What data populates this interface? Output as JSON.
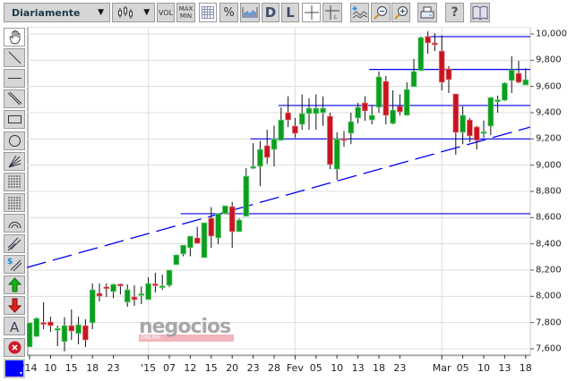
{
  "toolbar": {
    "period_select": "Diariamente",
    "chart_type_icon": "candlestick-icon",
    "vol_label": "VOL",
    "maxmin_label": "MAX MIN",
    "d_label": "D",
    "l_label": "L",
    "help_label": "?"
  },
  "left_tools": [
    "hand-icon",
    "line-icon",
    "horizontal-line-icon",
    "parallel-lines-icon",
    "rectangle-icon",
    "circle-icon",
    "fan-icon",
    "vertical-grid-icon",
    "horizontal-grid-icon",
    "arc-icon",
    "channel-icon",
    "dollar-channel-icon",
    "up-arrow-icon",
    "down-arrow-icon",
    "text-icon",
    "delete-icon",
    "color-picker-icon"
  ],
  "text_tool_label": "A",
  "colors": {
    "up": "#0b9e1f",
    "down": "#c8141f",
    "line": "#0000ee",
    "selected_color": "#0000ff"
  },
  "watermark": {
    "brand": "negocios",
    "sub": "ONLINE"
  },
  "chart_data": {
    "type": "candlestick",
    "ylim": [
      7550,
      10060
    ],
    "y_ticks": [
      {
        "v": 10000,
        "label": "10,000"
      },
      {
        "v": 9800,
        "label": "9,800"
      },
      {
        "v": 9600,
        "label": "9,600"
      },
      {
        "v": 9400,
        "label": "9,400"
      },
      {
        "v": 9200,
        "label": "9,200"
      },
      {
        "v": 9000,
        "label": "9,000"
      },
      {
        "v": 8800,
        "label": "8,800"
      },
      {
        "v": 8600,
        "label": "8,600"
      },
      {
        "v": 8400,
        "label": "8,400"
      },
      {
        "v": 8200,
        "label": "8,200"
      },
      {
        "v": 8000,
        "label": "8,000"
      },
      {
        "v": 7800,
        "label": "7,800"
      },
      {
        "v": 7600,
        "label": "7,600"
      }
    ],
    "x_ticks": [
      {
        "i": 0,
        "label": "'14"
      },
      {
        "i": 3,
        "label": "10"
      },
      {
        "i": 6,
        "label": "15"
      },
      {
        "i": 9,
        "label": "18"
      },
      {
        "i": 12,
        "label": "23"
      },
      {
        "i": 17,
        "label": "'15"
      },
      {
        "i": 20,
        "label": "07"
      },
      {
        "i": 23,
        "label": "12"
      },
      {
        "i": 26,
        "label": "15"
      },
      {
        "i": 29,
        "label": "20"
      },
      {
        "i": 32,
        "label": "23"
      },
      {
        "i": 35,
        "label": "28"
      },
      {
        "i": 38,
        "label": "Fev"
      },
      {
        "i": 41,
        "label": "05"
      },
      {
        "i": 44,
        "label": "10"
      },
      {
        "i": 47,
        "label": "13"
      },
      {
        "i": 50,
        "label": "18"
      },
      {
        "i": 53,
        "label": "23"
      },
      {
        "i": 59,
        "label": "Mar"
      },
      {
        "i": 62,
        "label": "05"
      },
      {
        "i": 65,
        "label": "10"
      },
      {
        "i": 68,
        "label": "13"
      },
      {
        "i": 71,
        "label": "18"
      }
    ],
    "v_grid_at": [
      17,
      38,
      59
    ],
    "ohlc": [
      [
        7614,
        7798,
        7614,
        7798
      ],
      [
        7695,
        7840,
        7690,
        7832
      ],
      [
        7800,
        7955,
        7750,
        7795
      ],
      [
        7805,
        7845,
        7730,
        7777
      ],
      [
        7750,
        7777,
        7620,
        7755
      ],
      [
        7655,
        7840,
        7580,
        7777
      ],
      [
        7777,
        7900,
        7668,
        7736
      ],
      [
        7716,
        7845,
        7634,
        7784
      ],
      [
        7777,
        7825,
        7614,
        7668
      ],
      [
        7798,
        8098,
        7750,
        8050
      ],
      [
        8023,
        8098,
        7961,
        8002
      ],
      [
        8072,
        8098,
        7995,
        8065
      ],
      [
        8036,
        8098,
        7985,
        8091
      ],
      [
        8093,
        8098,
        8015,
        8088
      ],
      [
        7955,
        8091,
        7920,
        8050
      ],
      [
        7995,
        8084,
        7927,
        7975
      ],
      [
        8015,
        8075,
        7940,
        8020
      ],
      [
        7975,
        8145,
        7975,
        8098
      ],
      [
        8095,
        8180,
        8030,
        8090
      ],
      [
        8075,
        8165,
        8050,
        8080
      ],
      [
        8084,
        8200,
        8070,
        8200
      ],
      [
        8241,
        8316,
        8241,
        8316
      ],
      [
        8323,
        8390,
        8305,
        8390
      ],
      [
        8370,
        8459,
        8305,
        8459
      ],
      [
        8445,
        8530,
        8404,
        8404
      ],
      [
        8295,
        8561,
        8295,
        8561
      ],
      [
        8595,
        8680,
        8370,
        8459
      ],
      [
        8445,
        8630,
        8398,
        8630
      ],
      [
        8630,
        8690,
        8630,
        8690
      ],
      [
        8684,
        8720,
        8370,
        8493
      ],
      [
        8493,
        8595,
        8500,
        8582
      ],
      [
        8610,
        8977,
        8610,
        8916
      ],
      [
        8985,
        9168,
        8970,
        8990
      ],
      [
        8991,
        9185,
        8841,
        9120
      ],
      [
        9148,
        9270,
        9010,
        9059
      ],
      [
        9120,
        9300,
        8990,
        9200
      ],
      [
        9189,
        9440,
        9189,
        9345
      ],
      [
        9400,
        9525,
        9290,
        9345
      ],
      [
        9298,
        9360,
        9209,
        9243
      ],
      [
        9311,
        9540,
        9270,
        9393
      ],
      [
        9393,
        9510,
        9270,
        9434
      ],
      [
        9393,
        9540,
        9270,
        9434
      ],
      [
        9400,
        9525,
        9300,
        9434
      ],
      [
        9373,
        9400,
        8970,
        9005
      ],
      [
        8970,
        9250,
        8889,
        9200
      ],
      [
        9202,
        9260,
        9140,
        9190
      ],
      [
        9243,
        9400,
        9160,
        9332
      ],
      [
        9359,
        9475,
        9318,
        9441
      ],
      [
        9475,
        9525,
        9338,
        9414
      ],
      [
        9345,
        9455,
        9311,
        9380
      ],
      [
        9441,
        9714,
        9400,
        9673
      ],
      [
        9639,
        9680,
        9311,
        9380
      ],
      [
        9318,
        9570,
        9311,
        9420
      ],
      [
        9448,
        9540,
        9380,
        9407
      ],
      [
        9380,
        9632,
        9380,
        9577
      ],
      [
        9598,
        9810,
        9598,
        9714
      ],
      [
        9720,
        9980,
        9720,
        9973
      ],
      [
        9980,
        10020,
        9850,
        9932
      ],
      [
        9932,
        10005,
        9870,
        9918
      ],
      [
        9870,
        9990,
        9570,
        9632
      ],
      [
        9734,
        9755,
        9550,
        9652
      ],
      [
        9543,
        9543,
        9080,
        9250
      ],
      [
        9250,
        9448,
        9160,
        9380
      ],
      [
        9345,
        9360,
        9175,
        9223
      ],
      [
        9291,
        9300,
        9120,
        9189
      ],
      [
        9250,
        9340,
        9210,
        9255
      ],
      [
        9298,
        9516,
        9230,
        9516
      ],
      [
        9493,
        9530,
        9400,
        9498
      ],
      [
        9495,
        9632,
        9489,
        9625
      ],
      [
        9645,
        9830,
        9550,
        9727
      ],
      [
        9700,
        9795,
        9625,
        9632
      ],
      [
        9611,
        9740,
        9618,
        9652
      ]
    ],
    "horizontal_lines": [
      {
        "v": 9980,
        "from": 57
      },
      {
        "v": 9730,
        "from": 49
      },
      {
        "v": 9455,
        "from": 36
      },
      {
        "v": 9200,
        "from": 32
      },
      {
        "v": 8630,
        "from": 22
      }
    ],
    "trend_line": {
      "from": [
        0,
        8220
      ],
      "to": [
        71,
        9290
      ]
    }
  }
}
